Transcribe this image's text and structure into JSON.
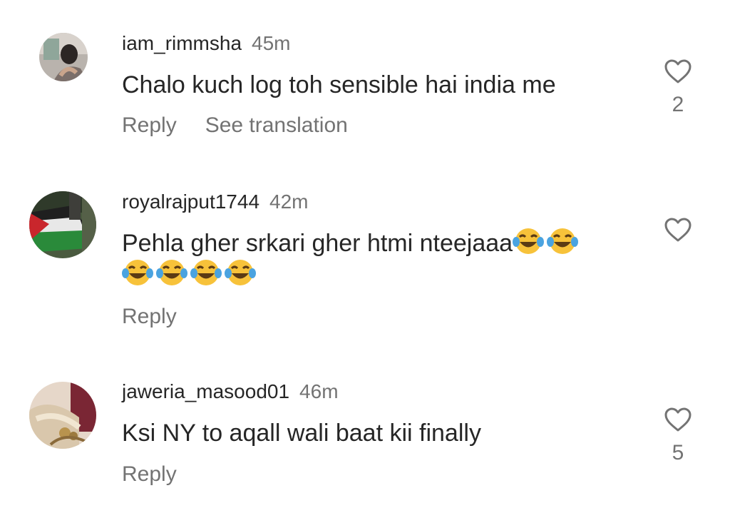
{
  "comments": [
    {
      "username": "iam_rimmsha",
      "time": "45m",
      "text": "Chalo kuch log toh sensible hai india me",
      "reply_label": "Reply",
      "translate_label": "See translation",
      "likes": "2",
      "avatar_icon": "user-avatar-photo"
    },
    {
      "username": "royalrajput1744",
      "time": "42m",
      "text": "Pehla gher srkari gher htmi nteejaaa",
      "emoji": "laughing-tears-emoji",
      "emoji_count_line1": 2,
      "emoji_count_line2": 4,
      "reply_label": "Reply",
      "likes": "",
      "avatar_icon": "flag-avatar-photo"
    },
    {
      "username": "jaweria_masood01",
      "time": "46m",
      "text": "Ksi NY to aqall wali baat kii finally",
      "reply_label": "Reply",
      "likes": "5",
      "avatar_icon": "user-avatar-photo"
    }
  ],
  "colors": {
    "text_primary": "#262626",
    "text_secondary": "#737373"
  }
}
